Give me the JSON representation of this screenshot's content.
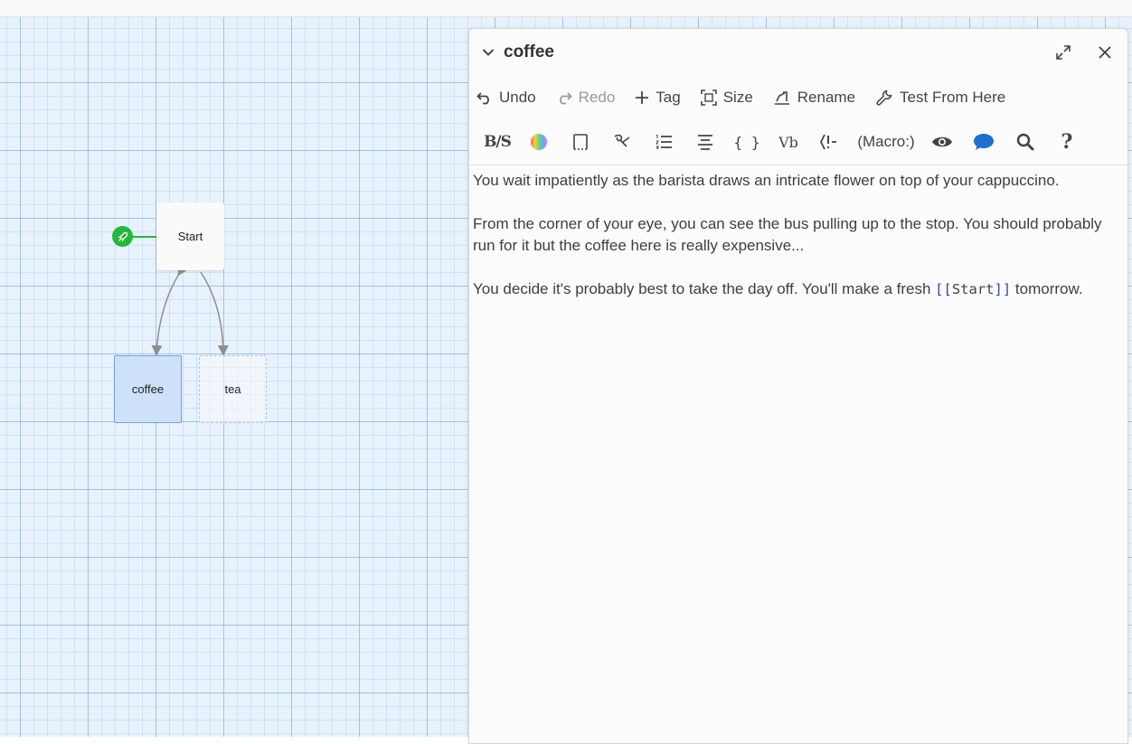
{
  "map": {
    "passages": {
      "start": "Start",
      "coffee": "coffee",
      "tea": "tea"
    },
    "start_marker_icon": "rocket-icon",
    "colors": {
      "start_marker": "#22b83a",
      "selected_passage": "#cde1f9",
      "selected_border": "#6fa3dd"
    }
  },
  "dialog": {
    "title": "coffee",
    "toolbar": {
      "undo": "Undo",
      "redo": "Redo",
      "tag": "Tag",
      "size": "Size",
      "rename": "Rename",
      "test_from_here": "Test From Here"
    },
    "format_toolbar": {
      "bold_strike": "B/S",
      "macro": "(Macro:)",
      "vb": "Vb"
    },
    "text": {
      "para1": "You wait impatiently as the barista draws an intricate flower on top of your cappuccino.",
      "para2": "From the corner of your eye, you can see the bus pulling up to the stop. You should probably run for it but the coffee here is really expensive...",
      "para3_before": "You decide it's probably best to take the day off. You'll make a fresh ",
      "link_open": "[[",
      "link_target": "Start",
      "link_close": "]]",
      "para3_after": " tomorrow."
    }
  }
}
